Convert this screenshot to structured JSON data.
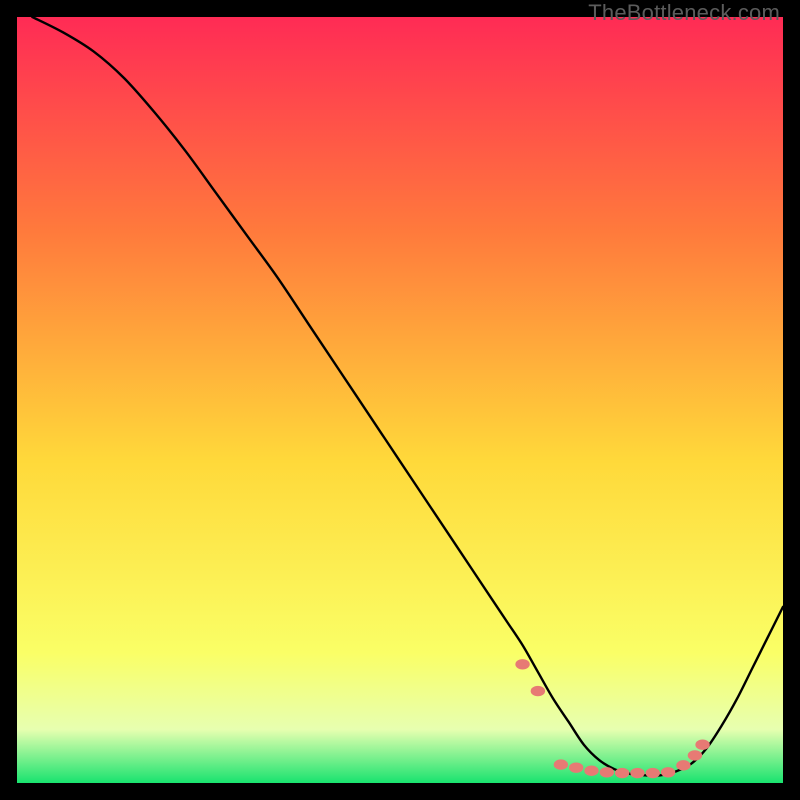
{
  "watermark": "TheBottleneck.com",
  "colors": {
    "frame": "#000000",
    "gradient_top": "#ff2b55",
    "gradient_mid_upper": "#ff7a3c",
    "gradient_mid": "#ffd93a",
    "gradient_mid_lower": "#faff66",
    "gradient_band_pale": "#e7ffb0",
    "gradient_bottom": "#19e36f",
    "curve": "#000000",
    "markers": "#e77a74"
  },
  "chart_data": {
    "type": "line",
    "title": "",
    "xlabel": "",
    "ylabel": "",
    "xlim": [
      0,
      100
    ],
    "ylim": [
      0,
      100
    ],
    "grid": false,
    "legend": false,
    "series": [
      {
        "name": "bottleneck-curve",
        "x": [
          2,
          6,
          10,
          14,
          18,
          22,
          26,
          30,
          34,
          38,
          42,
          46,
          50,
          54,
          58,
          62,
          64,
          66,
          68,
          70,
          72,
          74,
          76,
          78,
          80,
          82,
          84,
          86,
          88,
          90,
          92,
          94,
          96,
          98,
          100
        ],
        "y": [
          100,
          98,
          95.5,
          92,
          87.5,
          82.5,
          77,
          71.5,
          66,
          60,
          54,
          48,
          42,
          36,
          30,
          24,
          21,
          18,
          14.5,
          11,
          8,
          5,
          3,
          1.8,
          1.2,
          1.0,
          1.0,
          1.5,
          2.5,
          4.5,
          7.5,
          11,
          15,
          19,
          23
        ]
      }
    ],
    "markers": {
      "name": "highlighted-region",
      "x": [
        66,
        68,
        71,
        73,
        75,
        77,
        79,
        81,
        83,
        85,
        87,
        88.5,
        89.5
      ],
      "y": [
        15.5,
        12,
        2.4,
        2.0,
        1.6,
        1.4,
        1.3,
        1.3,
        1.3,
        1.4,
        2.3,
        3.6,
        5.0
      ]
    }
  }
}
